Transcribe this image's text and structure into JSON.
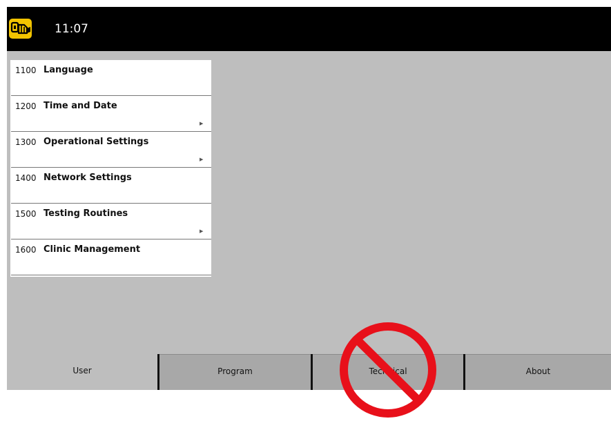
{
  "header": {
    "app_icon": "wrench-hand-icon",
    "time": "11:07"
  },
  "menu": {
    "items": [
      {
        "code": "1100",
        "label": "Language",
        "has_submenu": false
      },
      {
        "code": "1200",
        "label": "Time and Date",
        "has_submenu": true
      },
      {
        "code": "1300",
        "label": "Operational Settings",
        "has_submenu": true
      },
      {
        "code": "1400",
        "label": "Network Settings",
        "has_submenu": false
      },
      {
        "code": "1500",
        "label": "Testing Routines",
        "has_submenu": true
      },
      {
        "code": "1600",
        "label": "Clinic Management",
        "has_submenu": false
      }
    ],
    "chevron_icon": "chevron-right-icon",
    "chevron_glyph": "▶"
  },
  "tabs": [
    {
      "label": "User",
      "active": true
    },
    {
      "label": "Program",
      "active": false
    },
    {
      "label": "Technical",
      "active": false
    },
    {
      "label": "About",
      "active": false
    }
  ],
  "overlay": {
    "icon": "prohibited-icon",
    "color": "#e8101a"
  },
  "colors": {
    "topbar": "#000000",
    "screen_bg": "#bebebe",
    "icon_bg": "#f2c400",
    "tab_bg": "#a8a8a8"
  }
}
